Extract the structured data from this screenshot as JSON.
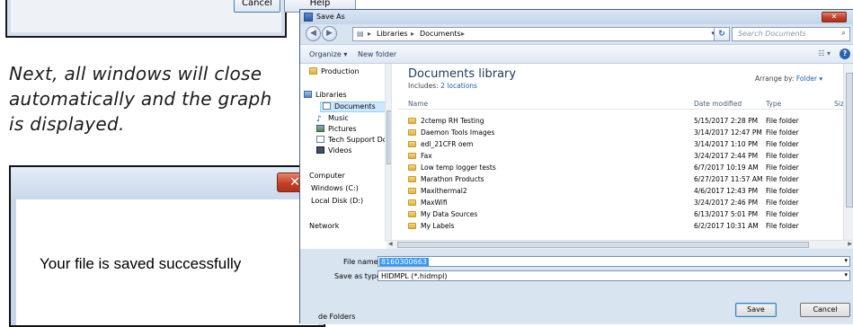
{
  "top_dialog": {
    "cancel_label": "Cancel",
    "help_label": "Help"
  },
  "instruction": "Next, all windows will close automatically and the graph is displayed.",
  "message_box": {
    "close_label": "✕",
    "message": "Your file is saved successfully"
  },
  "save_as": {
    "title": "Save As",
    "breadcrumb": [
      "Libraries",
      "Documents"
    ],
    "search_placeholder": "Search Documents",
    "toolbar": {
      "organize": "Organize ▾",
      "new_folder": "New folder"
    },
    "nav": [
      {
        "label": "Production",
        "icon": "folder-icon"
      },
      {
        "label": "Libraries",
        "icon": "libraries-icon"
      },
      {
        "label": "Documents",
        "icon": "documents-icon",
        "selected": true
      },
      {
        "label": "Music",
        "icon": "music-icon"
      },
      {
        "label": "Pictures",
        "icon": "pictures-icon"
      },
      {
        "label": "Tech Support Do",
        "icon": "documents-icon"
      },
      {
        "label": "Videos",
        "icon": "videos-icon"
      },
      {
        "label": "Computer",
        "icon": "computer-icon"
      },
      {
        "label": "Windows (C:)",
        "icon": "drive-icon"
      },
      {
        "label": "Local Disk (D:)",
        "icon": "drive-icon"
      },
      {
        "label": "Network",
        "icon": "network-icon"
      }
    ],
    "library": {
      "title": "Documents library",
      "includes_prefix": "Includes:",
      "includes_link": "2 locations",
      "arrange_prefix": "Arrange by:",
      "arrange_value": "Folder ▾"
    },
    "columns": {
      "name": "Name",
      "date": "Date modified",
      "type": "Type",
      "size": "Size"
    },
    "files": [
      {
        "name": "2ctemp RH Testing",
        "date": "5/15/2017 2:28 PM",
        "type": "File folder"
      },
      {
        "name": "Daemon Tools Images",
        "date": "3/14/2017 12:47 PM",
        "type": "File folder"
      },
      {
        "name": "edl_21CFR oem",
        "date": "3/14/2017 1:10 PM",
        "type": "File folder"
      },
      {
        "name": "Fax",
        "date": "3/24/2017 2:44 PM",
        "type": "File folder"
      },
      {
        "name": "Low temp logger tests",
        "date": "6/7/2017 10:19 AM",
        "type": "File folder"
      },
      {
        "name": "Marathon Products",
        "date": "6/27/2017 11:57 AM",
        "type": "File folder"
      },
      {
        "name": "Maxithermal2",
        "date": "4/6/2017 12:43 PM",
        "type": "File folder"
      },
      {
        "name": "MaxWifi",
        "date": "3/24/2017 2:46 PM",
        "type": "File folder"
      },
      {
        "name": "My Data Sources",
        "date": "6/13/2017 5:01 PM",
        "type": "File folder"
      },
      {
        "name": "My Labels",
        "date": "6/2/2017 10:31 AM",
        "type": "File folder"
      }
    ],
    "file_name_label": "File name:",
    "file_name_value": "8160300663",
    "save_type_label": "Save as type:",
    "save_type_value": "HIDMPL (*.hidmpl)",
    "hide_folders": "de Folders",
    "save_button": "Save",
    "cancel_button": "Cancel"
  }
}
